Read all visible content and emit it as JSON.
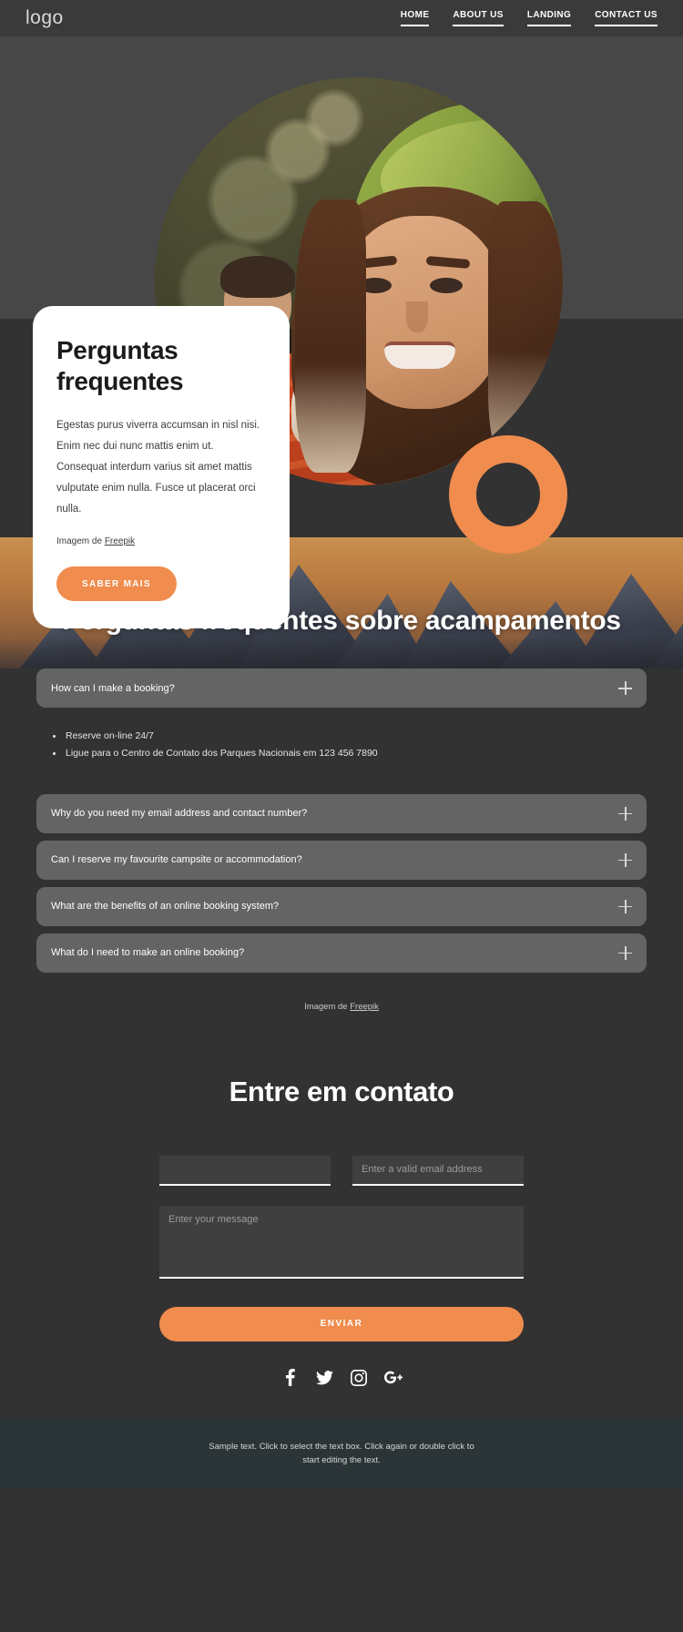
{
  "header": {
    "logo": "logo",
    "nav": [
      {
        "label": "HOME"
      },
      {
        "label": "ABOUT US"
      },
      {
        "label": "LANDING"
      },
      {
        "label": "CONTACT US"
      }
    ]
  },
  "hero": {
    "card": {
      "title": "Perguntas frequentes",
      "body": "Egestas purus viverra accumsan in nisl nisi. Enim nec dui nunc mattis enim ut. Consequat interdum varius sit amet mattis vulputate enim nulla. Fusce ut placerat orci nulla.",
      "credit_prefix": "Imagem de ",
      "credit_link": "Freepik",
      "button": "SABER MAIS"
    },
    "accent_color": "#f08c4e",
    "photo_alt": "Casal sorrindo em frente a uma barraca verde de acampamento"
  },
  "faq": {
    "title": "Perguntas frequentes sobre acampamentos",
    "banner_alt": "Cordilheira de montanhas ao entardecer",
    "items": [
      {
        "question": "How can I make a booking?",
        "expanded": true,
        "answers": [
          "Reserve on-line 24/7",
          "Ligue para o Centro de Contato dos Parques Nacionais em 123 456 7890"
        ]
      },
      {
        "question": "Why do you need my email address and contact number?",
        "expanded": false,
        "answers": []
      },
      {
        "question": "Can I reserve my favourite campsite or accommodation?",
        "expanded": false,
        "answers": []
      },
      {
        "question": "What are the benefits of an online booking system?",
        "expanded": false,
        "answers": []
      },
      {
        "question": "What do I need to make an online booking?",
        "expanded": false,
        "answers": []
      }
    ],
    "credit_prefix": "Imagem de ",
    "credit_link": "Freepik"
  },
  "contact": {
    "title": "Entre em contato",
    "name_value": "",
    "name_placeholder": "",
    "email_value": "",
    "email_placeholder": "Enter a valid email address",
    "message_value": "",
    "message_placeholder": "Enter your message",
    "submit": "ENVIAR",
    "socials": [
      {
        "name": "facebook"
      },
      {
        "name": "twitter"
      },
      {
        "name": "instagram"
      },
      {
        "name": "google-plus"
      }
    ]
  },
  "footer": {
    "text": "Sample text. Click to select the text box. Click again or double click to start editing the text."
  }
}
